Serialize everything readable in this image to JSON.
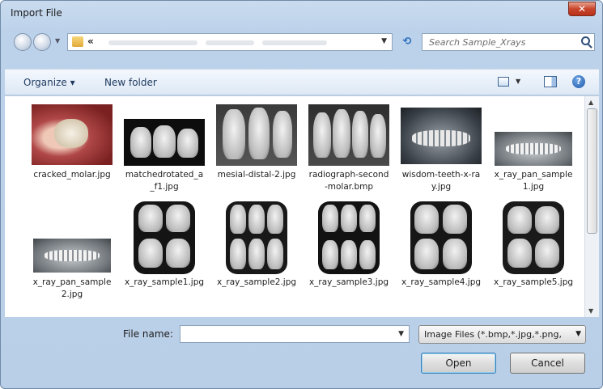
{
  "window": {
    "title": "Import File",
    "close_glyph": "✕"
  },
  "address": {
    "chevron": "«",
    "refresh_glyph": "⟲"
  },
  "search": {
    "placeholder": "Search Sample_Xrays"
  },
  "toolbar": {
    "organize": "Organize ▾",
    "new_folder": "New folder",
    "help": "?"
  },
  "files": [
    {
      "name": "cracked_molar.jpg",
      "type": "photo-red"
    },
    {
      "name": "matchedrotated_a_f1.jpg",
      "type": "bitewing-dark"
    },
    {
      "name": "mesial-distal-2.jpg",
      "type": "periapical"
    },
    {
      "name": "radiograph-second-molar.bmp",
      "type": "periapical"
    },
    {
      "name": "wisdom-teeth-x-ray.jpg",
      "type": "panoramic"
    },
    {
      "name": "x_ray_pan_sample1.jpg",
      "type": "panoramic-light"
    },
    {
      "name": "x_ray_pan_sample2.jpg",
      "type": "panoramic-light"
    },
    {
      "name": "x_ray_sample1.jpg",
      "type": "bitewing"
    },
    {
      "name": "x_ray_sample2.jpg",
      "type": "bitewing"
    },
    {
      "name": "x_ray_sample3.jpg",
      "type": "bitewing"
    },
    {
      "name": "x_ray_sample4.jpg",
      "type": "bitewing"
    },
    {
      "name": "x_ray_sample5.jpg",
      "type": "bitewing"
    }
  ],
  "bottom": {
    "file_name_label": "File name:",
    "file_name_value": "",
    "filter": "Image Files (*.bmp,*.jpg,*.png,",
    "open": "Open",
    "cancel": "Cancel"
  }
}
